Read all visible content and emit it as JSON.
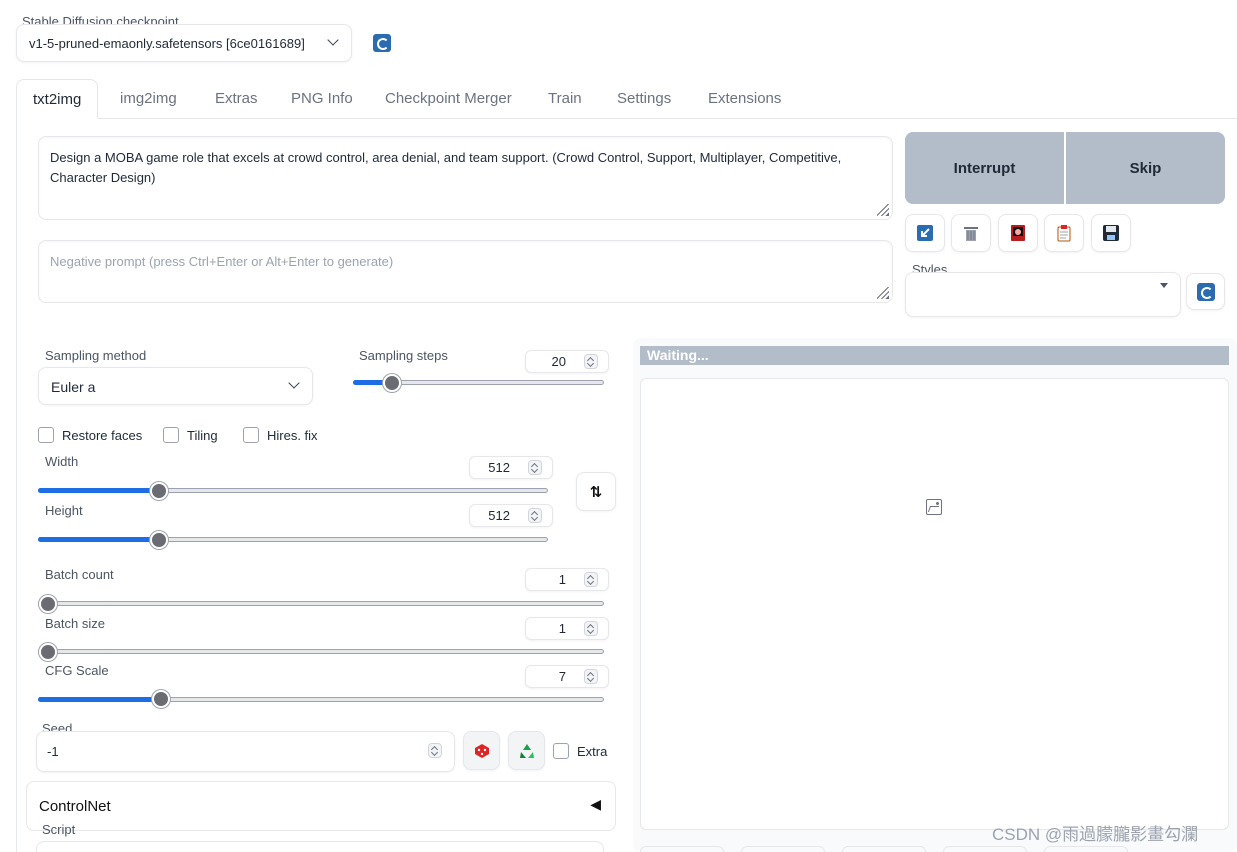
{
  "checkpoint": {
    "label": "Stable Diffusion checkpoint",
    "value": "v1-5-pruned-emaonly.safetensors [6ce0161689]"
  },
  "tabs": [
    "txt2img",
    "img2img",
    "Extras",
    "PNG Info",
    "Checkpoint Merger",
    "Train",
    "Settings",
    "Extensions"
  ],
  "prompt": {
    "text": "Design a MOBA game role that excels at crowd control, area denial, and team support. (Crowd Control, Support, Multiplayer, Competitive, Character Design)",
    "negative_placeholder": "Negative prompt (press Ctrl+Enter or Alt+Enter to generate)"
  },
  "actions": {
    "interrupt": "Interrupt",
    "skip": "Skip"
  },
  "styles": {
    "label": "Styles",
    "value": ""
  },
  "sampling": {
    "method_label": "Sampling method",
    "method_value": "Euler a",
    "steps_label": "Sampling steps",
    "steps_value": "20"
  },
  "checkboxes": {
    "restore_faces": "Restore faces",
    "tiling": "Tiling",
    "hires_fix": "Hires. fix",
    "extra": "Extra"
  },
  "width": {
    "label": "Width",
    "value": "512"
  },
  "height": {
    "label": "Height",
    "value": "512"
  },
  "batch_count": {
    "label": "Batch count",
    "value": "1"
  },
  "batch_size": {
    "label": "Batch size",
    "value": "1"
  },
  "cfg_scale": {
    "label": "CFG Scale",
    "value": "7"
  },
  "seed": {
    "label": "Seed",
    "value": "-1"
  },
  "controlnet": {
    "label": "ControlNet",
    "arrow": "◀"
  },
  "script": {
    "label": "Script"
  },
  "swap_icon": "⇅",
  "output": {
    "status": "Waiting..."
  },
  "watermark": "CSDN @雨過朦朧影畫勾瀾",
  "colors": {
    "accent": "#1d6ee6",
    "action_bg": "#b3bdc9"
  },
  "icons": [
    "refresh-icon",
    "paste-icon",
    "trash-icon",
    "style-apply-icon",
    "clipboard-icon",
    "save-icon",
    "dice-icon",
    "recycle-icon",
    "swap-icon",
    "image-placeholder-icon"
  ]
}
